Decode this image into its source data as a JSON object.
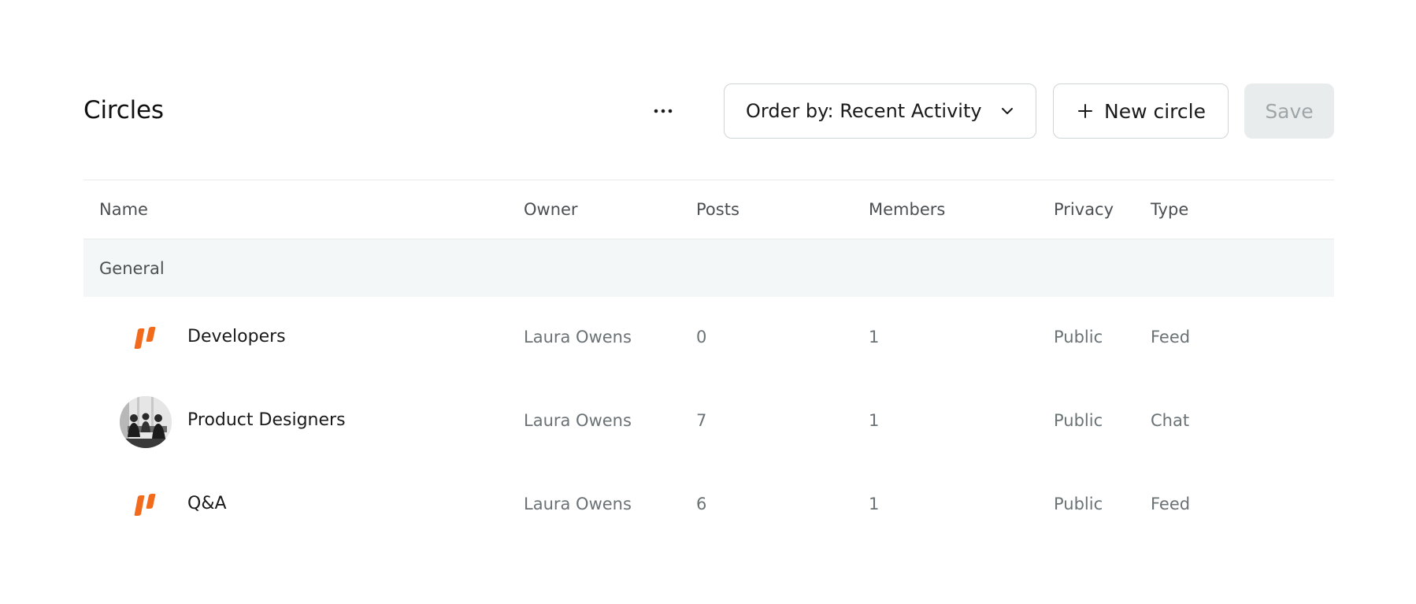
{
  "header": {
    "title": "Circles",
    "more_icon": "more-horizontal-icon",
    "order_label": "Order by: Recent Activity",
    "new_label": "New circle",
    "save_label": "Save"
  },
  "table": {
    "columns": {
      "name": "Name",
      "owner": "Owner",
      "posts": "Posts",
      "members": "Members",
      "privacy": "Privacy",
      "type": "Type"
    },
    "group": "General",
    "rows": [
      {
        "name": "Developers",
        "owner": "Laura Owens",
        "posts": "0",
        "members": "1",
        "privacy": "Public",
        "type": "Feed",
        "icon": "brand-logo-icon"
      },
      {
        "name": "Product Designers",
        "owner": "Laura Owens",
        "posts": "7",
        "members": "1",
        "privacy": "Public",
        "type": "Chat",
        "icon": "group-photo-avatar"
      },
      {
        "name": "Q&A",
        "owner": "Laura Owens",
        "posts": "6",
        "members": "1",
        "privacy": "Public",
        "type": "Feed",
        "icon": "brand-logo-icon"
      }
    ]
  },
  "colors": {
    "accent": "#f26b1d",
    "save_bg": "#e8ecec",
    "group_bg": "#f4f7f7"
  }
}
